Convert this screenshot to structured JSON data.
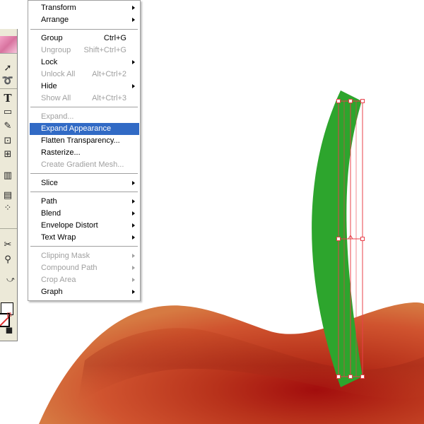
{
  "menu": {
    "transform": {
      "label": "Transform"
    },
    "arrange": {
      "label": "Arrange"
    },
    "group": {
      "label": "Group",
      "shortcut": "Ctrl+G"
    },
    "ungroup": {
      "label": "Ungroup",
      "shortcut": "Shift+Ctrl+G"
    },
    "lock": {
      "label": "Lock"
    },
    "unlock_all": {
      "label": "Unlock All",
      "shortcut": "Alt+Ctrl+2"
    },
    "hide": {
      "label": "Hide"
    },
    "show_all": {
      "label": "Show All",
      "shortcut": "Alt+Ctrl+3"
    },
    "expand": {
      "label": "Expand..."
    },
    "expand_appearance": {
      "label": "Expand Appearance"
    },
    "flatten_transparency": {
      "label": "Flatten Transparency..."
    },
    "rasterize": {
      "label": "Rasterize..."
    },
    "create_gradient_mesh": {
      "label": "Create Gradient Mesh..."
    },
    "slice": {
      "label": "Slice"
    },
    "path": {
      "label": "Path"
    },
    "blend": {
      "label": "Blend"
    },
    "envelope_distort": {
      "label": "Envelope Distort"
    },
    "text_wrap": {
      "label": "Text Wrap"
    },
    "clipping_mask": {
      "label": "Clipping Mask"
    },
    "compound_path": {
      "label": "Compound Path"
    },
    "crop_area": {
      "label": "Crop Area"
    },
    "graph": {
      "label": "Graph"
    }
  },
  "tools": {
    "type_glyph": "T"
  },
  "colors": {
    "stem_green": "#2da52d",
    "apple_red": "#b3301d",
    "selection_red": "#e8404a",
    "menu_highlight": "#316ac5"
  }
}
